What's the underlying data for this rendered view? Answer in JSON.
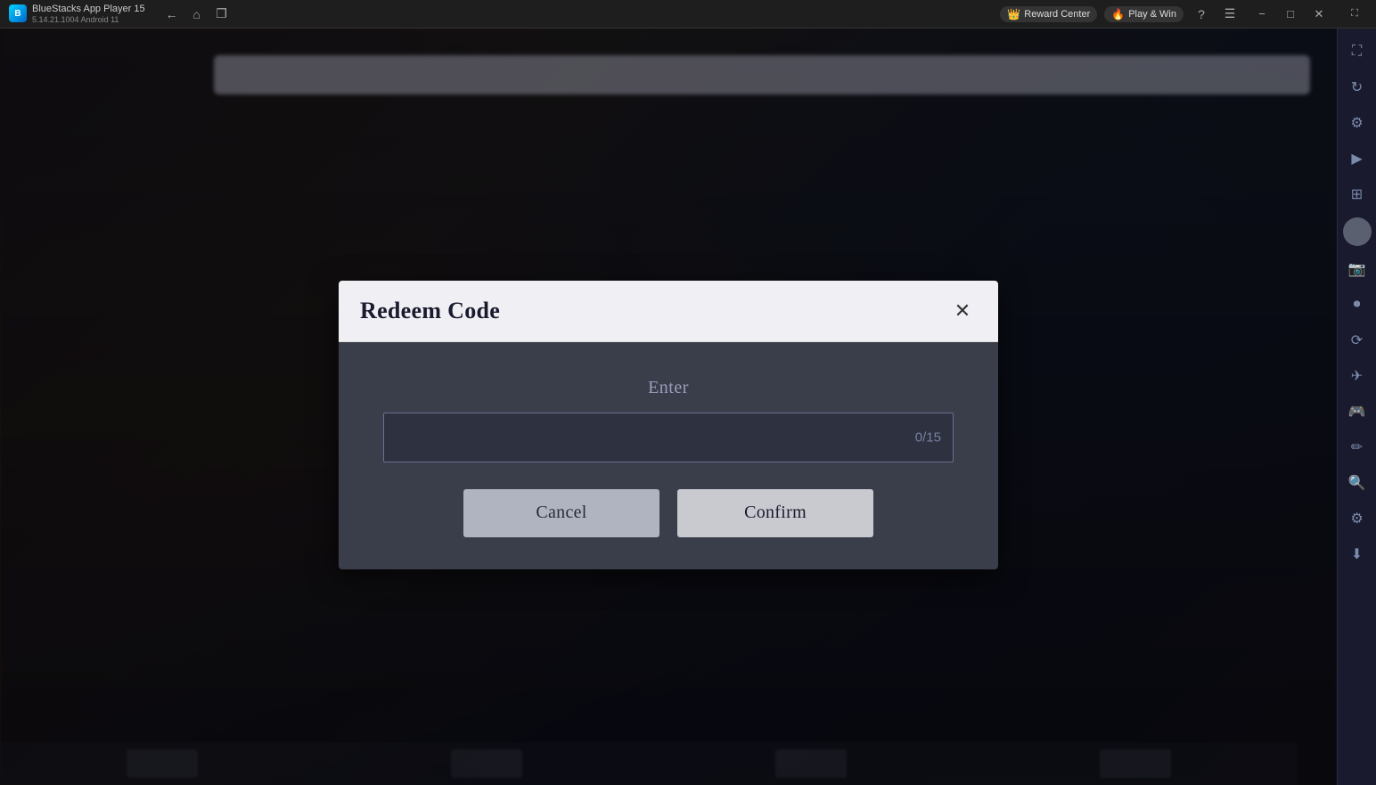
{
  "app": {
    "name": "BlueStacks App Player 15",
    "version": "5.14.21.1004  Android 11"
  },
  "topbar": {
    "back_icon": "←",
    "home_icon": "⌂",
    "copy_icon": "❐",
    "reward_label": "Reward Center",
    "play_win_label": "Play & Win",
    "help_icon": "?",
    "menu_icon": "☰",
    "minimize_icon": "−",
    "maximize_icon": "□",
    "close_icon": "✕",
    "expand_icon": "⛶"
  },
  "dialog": {
    "title": "Redeem Code",
    "close_icon": "✕",
    "enter_label": "Enter",
    "input_value": "",
    "input_placeholder": "",
    "counter": "0/15",
    "cancel_label": "Cancel",
    "confirm_label": "Confirm"
  },
  "sidebar": {
    "icons": [
      {
        "name": "expand-icon",
        "glyph": "⛶"
      },
      {
        "name": "refresh-icon",
        "glyph": "↻"
      },
      {
        "name": "settings-icon",
        "glyph": "⚙"
      },
      {
        "name": "play-icon",
        "glyph": "▶"
      },
      {
        "name": "grid-icon",
        "glyph": "⊞"
      },
      {
        "name": "camera-icon",
        "glyph": "📷"
      },
      {
        "name": "record-icon",
        "glyph": "⏺"
      },
      {
        "name": "rotate-icon",
        "glyph": "⟳"
      },
      {
        "name": "drone-icon",
        "glyph": "✈"
      },
      {
        "name": "gamepad-icon",
        "glyph": "🎮"
      },
      {
        "name": "brush-icon",
        "glyph": "✏"
      },
      {
        "name": "search-icon",
        "glyph": "🔍"
      },
      {
        "name": "gear2-icon",
        "glyph": "⚙"
      },
      {
        "name": "download-icon",
        "glyph": "⬇"
      }
    ]
  }
}
